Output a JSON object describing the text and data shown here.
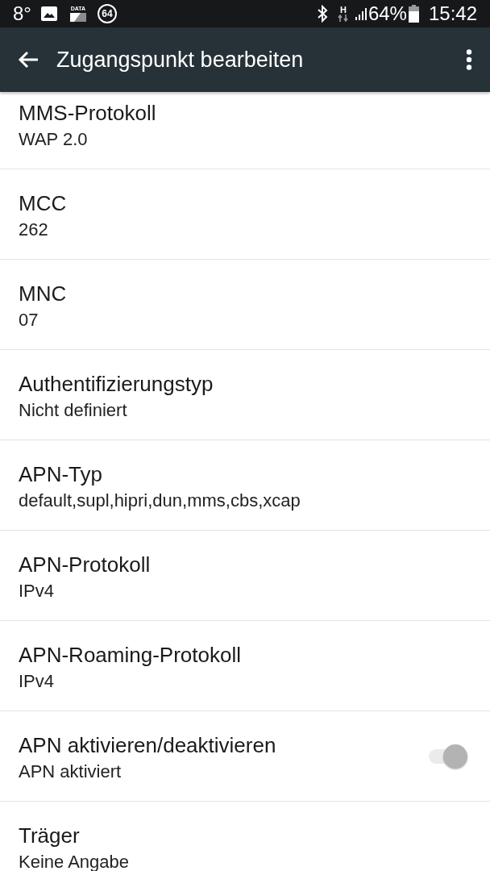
{
  "status_bar": {
    "temperature": "8°",
    "data_label": "DATA",
    "badge": "64",
    "network_type": "H",
    "battery": "64%",
    "time": "15:42"
  },
  "toolbar": {
    "title": "Zugangspunkt bearbeiten"
  },
  "settings": [
    {
      "kind": "text",
      "title": "MMS-Protokoll",
      "value": "WAP 2.0"
    },
    {
      "kind": "text",
      "title": "MCC",
      "value": "262"
    },
    {
      "kind": "text",
      "title": "MNC",
      "value": "07"
    },
    {
      "kind": "text",
      "title": "Authentifizierungstyp",
      "value": "Nicht definiert"
    },
    {
      "kind": "text",
      "title": "APN-Typ",
      "value": "default,supl,hipri,dun,mms,cbs,xcap"
    },
    {
      "kind": "text",
      "title": "APN-Protokoll",
      "value": "IPv4"
    },
    {
      "kind": "text",
      "title": "APN-Roaming-Protokoll",
      "value": "IPv4"
    },
    {
      "kind": "toggle",
      "title": "APN aktivieren/deaktivieren",
      "value": "APN aktiviert",
      "on": true,
      "disabled": true
    },
    {
      "kind": "text",
      "title": "Träger",
      "value": "Keine Angabe"
    }
  ]
}
